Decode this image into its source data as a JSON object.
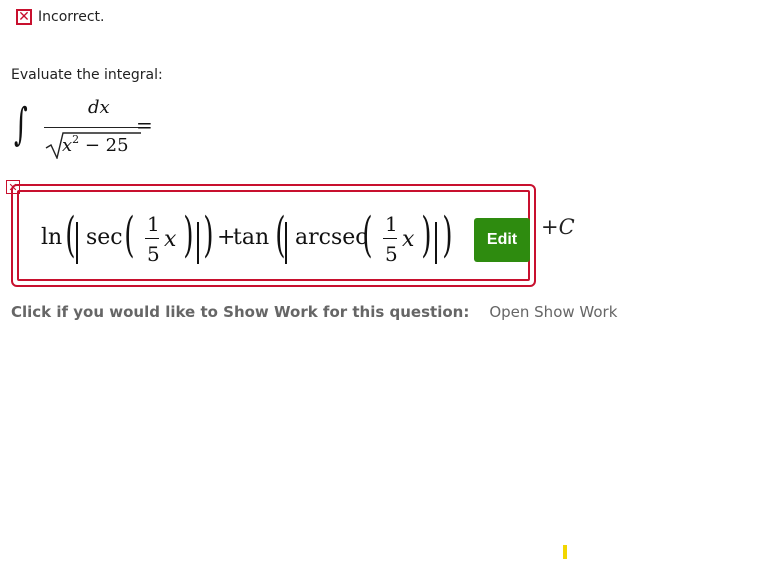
{
  "feedback": {
    "icon": "x-mark-icon",
    "status_text": "Incorrect."
  },
  "question": {
    "prompt": "Evaluate the integral:",
    "integral": {
      "numerator": "dx",
      "denominator_var": "x",
      "denominator_exp": "2",
      "denominator_rest": " − 25",
      "equals": "="
    }
  },
  "answer": {
    "flag_icon": "x-mark-icon",
    "ln": "ln",
    "sec": "sec",
    "plus": "+",
    "tan": "tan",
    "arcsec": "arcsec",
    "frac_num": "1",
    "frac_den": "5",
    "var": "x",
    "edit_label": "Edit",
    "constant_plus": "+",
    "constant": "C"
  },
  "show_work": {
    "label": "Click if you would like to Show Work for this question:",
    "link": "Open Show Work"
  },
  "colors": {
    "error_red": "#c8102e",
    "edit_green": "#2e8b0f",
    "cursor_yellow": "#f2d600"
  }
}
